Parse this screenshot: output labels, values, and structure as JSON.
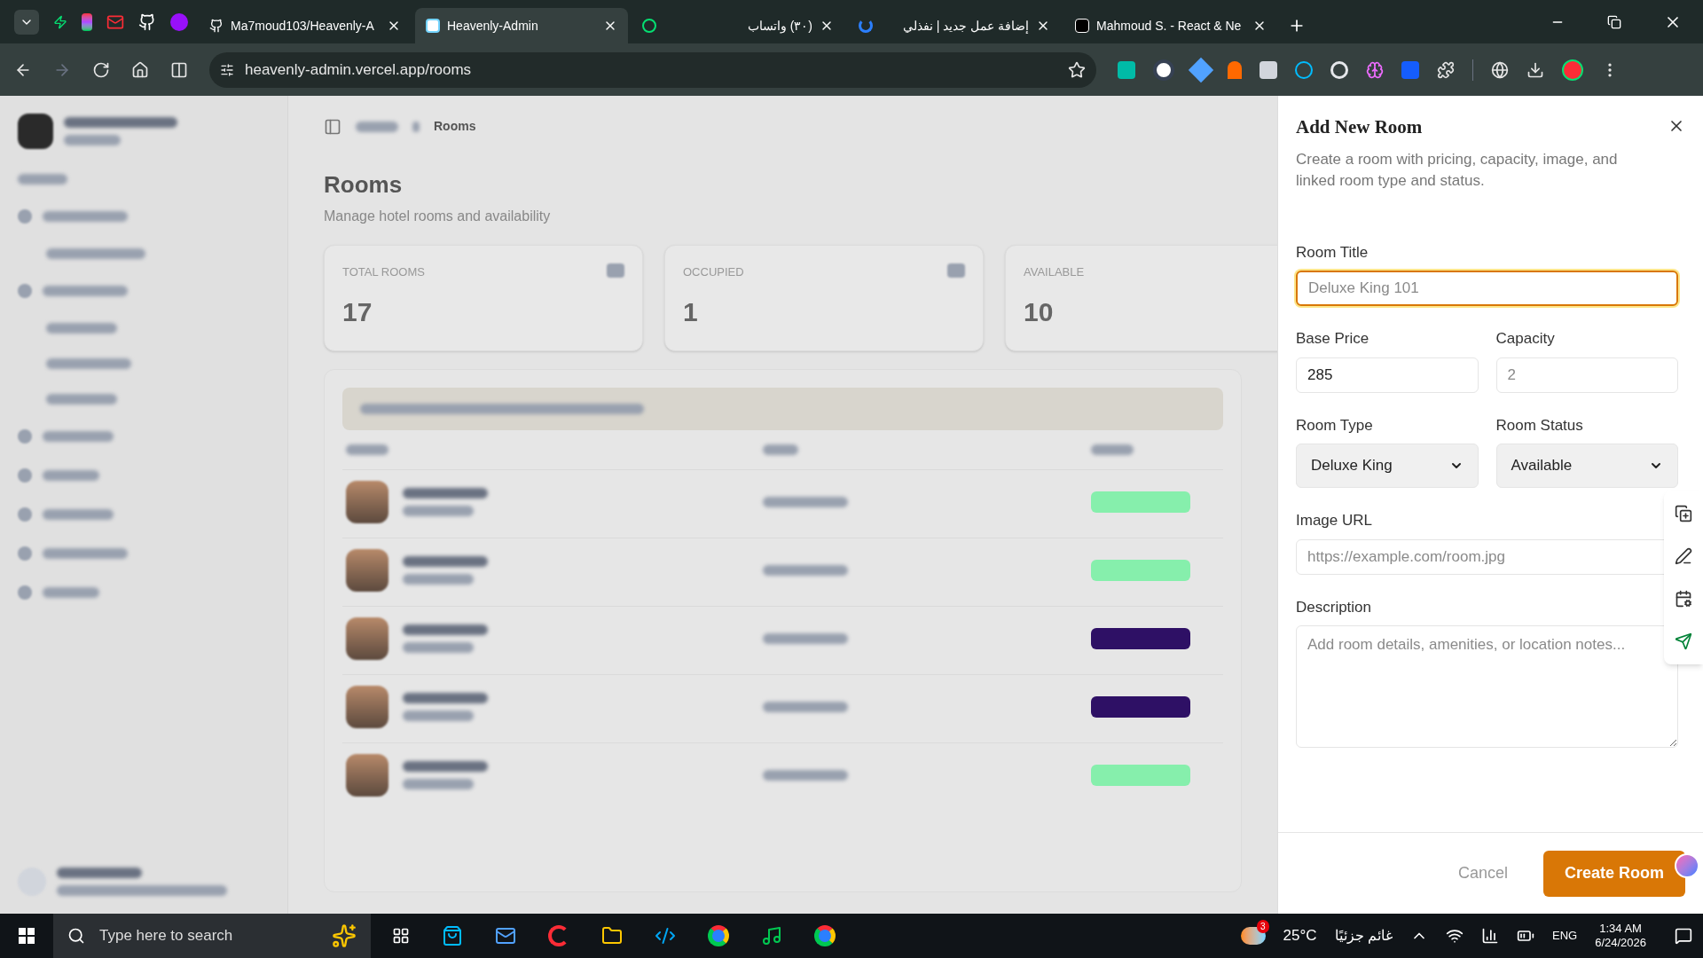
{
  "browser": {
    "tabs": [
      {
        "label": "Ma7moud103/Heavenly-A",
        "selected": false,
        "kind": "github"
      },
      {
        "label": "Heavenly-Admin",
        "selected": true,
        "kind": "site"
      },
      {
        "label": "(٣٠) واتساب",
        "selected": false,
        "kind": "whatsapp"
      },
      {
        "label": "إضافة عمل جديد | نفذلي",
        "selected": false,
        "kind": "nafezly"
      },
      {
        "label": "Mahmoud S. - React & Ne",
        "selected": false,
        "kind": "upwork"
      }
    ],
    "address": "heavenly-admin.vercel.app/rooms"
  },
  "page": {
    "breadcrumb_current": "Rooms",
    "heading": "Rooms",
    "subheading": "Manage hotel rooms and availability",
    "stats": [
      {
        "label": "TOTAL ROOMS",
        "value": "17"
      },
      {
        "label": "OCCUPIED",
        "value": "1"
      },
      {
        "label": "AVAILABLE",
        "value": "10"
      }
    ],
    "rows": [
      {
        "color": "#86efac"
      },
      {
        "color": "#86efac"
      },
      {
        "color": "#2e1065"
      },
      {
        "color": "#2e1065"
      },
      {
        "color": "#86efac"
      }
    ]
  },
  "drawer": {
    "title": "Add New Room",
    "description": "Create a room with pricing, capacity, image, and linked room type and status.",
    "field_rows": [
      [
        {
          "label": "Room Title",
          "kind": "text",
          "placeholder": "Deluxe King 101",
          "focused": true
        }
      ],
      [
        {
          "label": "Base Price",
          "kind": "text",
          "value": "285",
          "focused": false
        },
        {
          "label": "Capacity",
          "kind": "text",
          "placeholder": "2",
          "focused": false
        }
      ],
      [
        {
          "label": "Room Type",
          "kind": "select",
          "value": "Deluxe King",
          "focused": false
        },
        {
          "label": "Room Status",
          "kind": "select",
          "value": "Available",
          "focused": false
        }
      ],
      [
        {
          "label": "Image URL",
          "kind": "text",
          "placeholder": "https://example.com/room.jpg",
          "focused": false
        }
      ],
      [
        {
          "label": "Description",
          "kind": "textarea",
          "placeholder": "Add room details, amenities, or location notes...",
          "focused": false
        }
      ]
    ],
    "cancel": "Cancel",
    "submit": "Create Room"
  },
  "taskbar": {
    "search_placeholder": "Type here to search",
    "weather_badge": "3",
    "temperature": "25°C",
    "weather": "غائم جزئيًا",
    "language": "ENG",
    "time": "1:34 AM",
    "date": "6/24/2026"
  }
}
